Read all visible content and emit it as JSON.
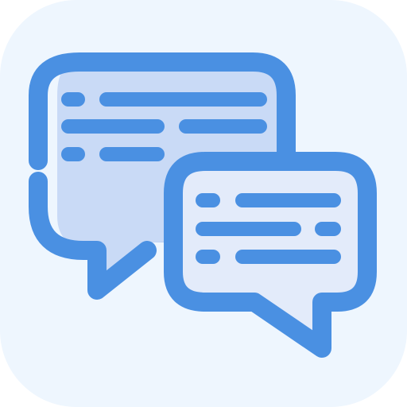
{
  "icon": {
    "name": "chat-bubbles-icon",
    "colors": {
      "tile": "#EEF6FE",
      "stroke": "#4A90E2",
      "bubble_back_fill": "#C9DAF6",
      "bubble_back_shadow": "#B6CDF2",
      "bubble_front_fill": "#E3EBFA",
      "bubble_front_shadow": "#C9DAF6"
    }
  }
}
